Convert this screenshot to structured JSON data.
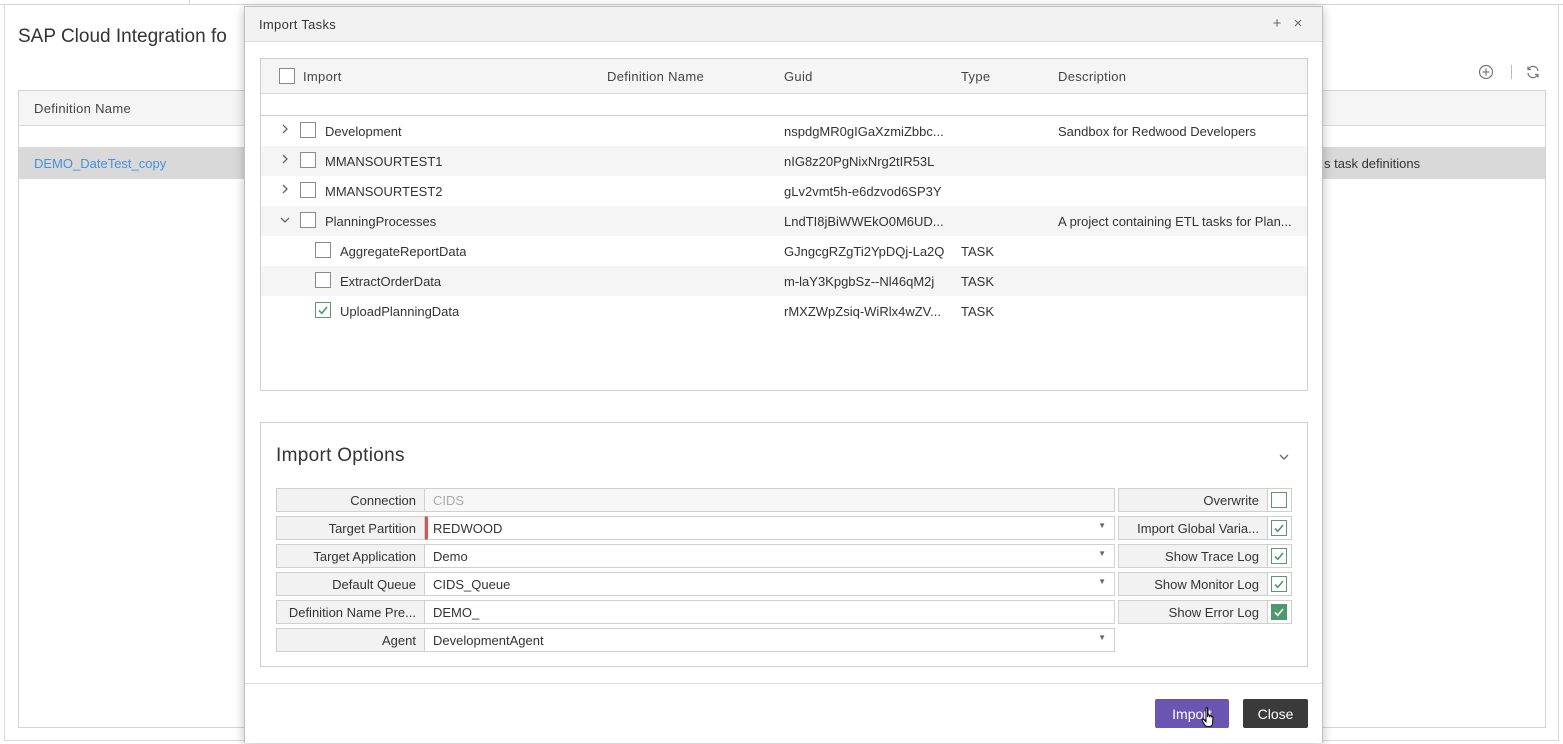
{
  "background": {
    "page_title": "SAP Cloud Integration fo",
    "table_header": "Definition Name",
    "row_name": "DEMO_DateTest_copy",
    "row_description_fragment": "s task definitions"
  },
  "modal": {
    "title": "Import Tasks",
    "maximize_glyph": "+",
    "close_glyph": "×",
    "tasks_table": {
      "columns": [
        "Import",
        "Definition Name",
        "Guid",
        "Type",
        "Description"
      ],
      "rows": [
        {
          "level": 0,
          "expand": "collapsed",
          "checked": false,
          "name": "Development",
          "guid": "nspdgMR0gIGaXzmiZbbc...",
          "type": "",
          "description": "Sandbox for Redwood Developers"
        },
        {
          "level": 0,
          "expand": "collapsed",
          "checked": false,
          "name": "MMANSOURTEST1",
          "guid": "nIG8z20PgNixNrg2tIR53L",
          "type": "",
          "description": ""
        },
        {
          "level": 0,
          "expand": "collapsed",
          "checked": false,
          "name": "MMANSOURTEST2",
          "guid": "gLv2vmt5h-e6dzvod6SP3Y",
          "type": "",
          "description": ""
        },
        {
          "level": 0,
          "expand": "expanded",
          "checked": false,
          "name": "PlanningProcesses",
          "guid": "LndTI8jBiWWEkO0M6UD...",
          "type": "",
          "description": "A project containing ETL tasks for Plan..."
        },
        {
          "level": 1,
          "expand": "none",
          "checked": false,
          "name": "AggregateReportData",
          "guid": "GJngcgRZgTi2YpDQj-La2Q",
          "type": "TASK",
          "description": ""
        },
        {
          "level": 1,
          "expand": "none",
          "checked": false,
          "name": "ExtractOrderData",
          "guid": "m-laY3KpgbSz--Nl46qM2j",
          "type": "TASK",
          "description": ""
        },
        {
          "level": 1,
          "expand": "none",
          "checked": true,
          "name": "UploadPlanningData",
          "guid": "rMXZWpZsiq-WiRlx4wZV...",
          "type": "TASK",
          "description": ""
        }
      ]
    },
    "options": {
      "title": "Import Options",
      "fields": {
        "connection": {
          "label": "Connection",
          "value": "CIDS"
        },
        "target_partition": {
          "label": "Target Partition",
          "value": "REDWOOD"
        },
        "target_application": {
          "label": "Target Application",
          "value": "Demo"
        },
        "default_queue": {
          "label": "Default Queue",
          "value": "CIDS_Queue"
        },
        "definition_name_prefix": {
          "label": "Definition Name Pre...",
          "value": "DEMO_"
        },
        "agent": {
          "label": "Agent",
          "value": "DevelopmentAgent"
        }
      },
      "checks": {
        "overwrite": {
          "label": "Overwrite",
          "checked": false
        },
        "import_global_variables": {
          "label": "Import Global Varia...",
          "checked": true
        },
        "show_trace_log": {
          "label": "Show Trace Log",
          "checked": true
        },
        "show_monitor_log": {
          "label": "Show Monitor Log",
          "checked": true
        },
        "show_error_log": {
          "label": "Show Error Log",
          "checked": true
        }
      }
    },
    "footer": {
      "import_label": "Import",
      "close_label": "Close"
    }
  },
  "colors": {
    "import_button": "#6a55b0",
    "close_button": "#3a3a3a",
    "check_green": "#4e9a6e",
    "link_blue": "#4a90d9",
    "required_marker": "#d9534f"
  }
}
